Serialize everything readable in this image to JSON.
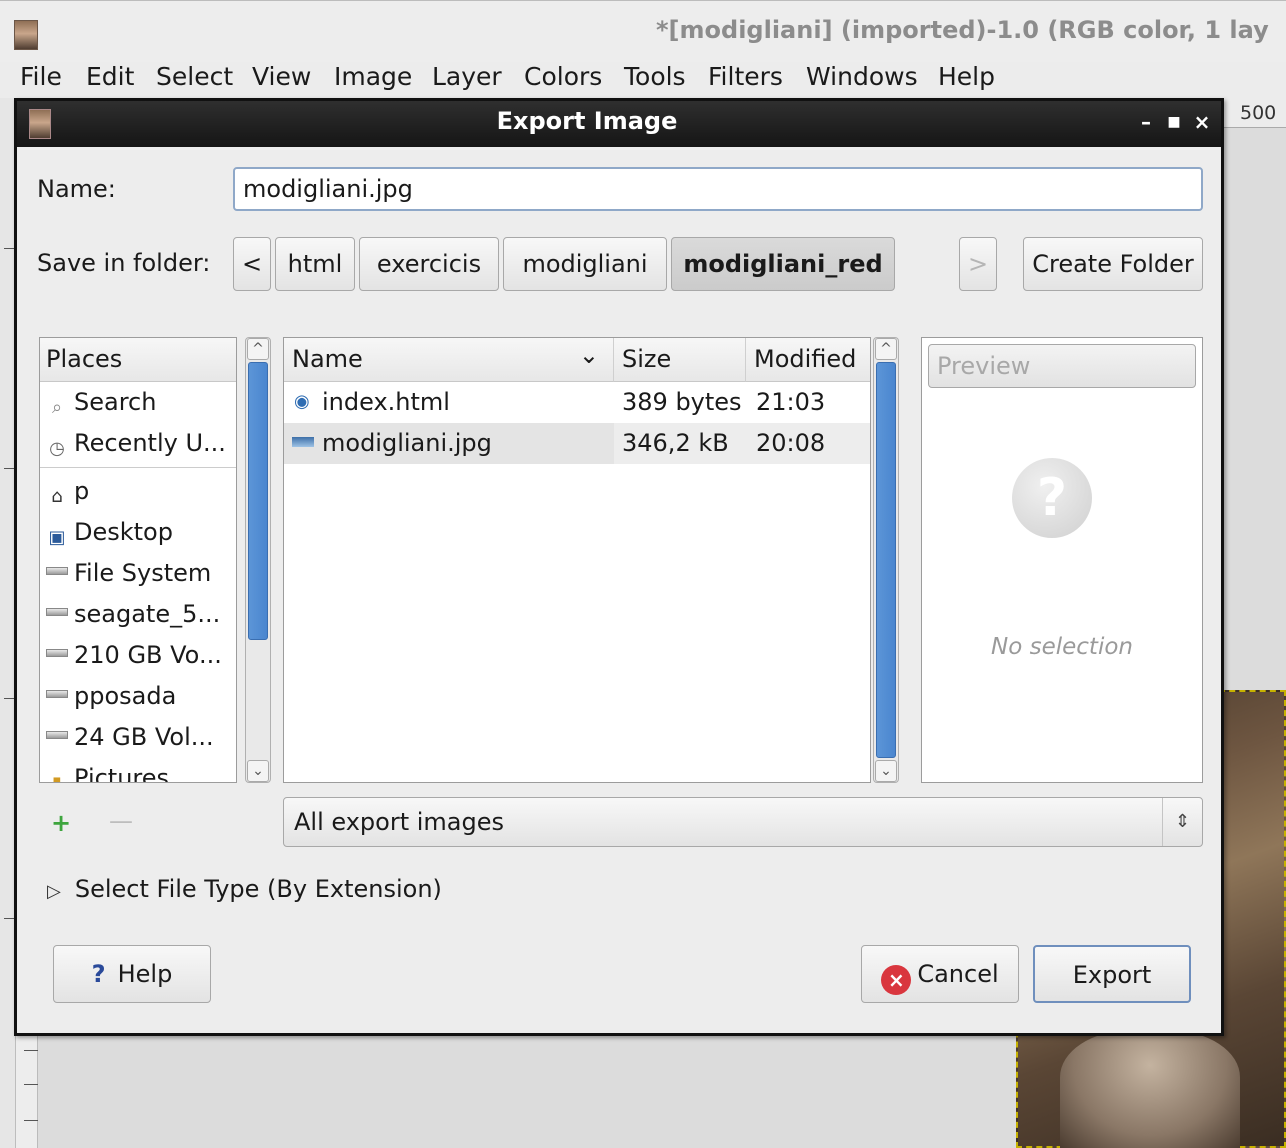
{
  "window": {
    "title": "*[modigliani] (imported)-1.0 (RGB color, 1 lay",
    "ruler_label": "500"
  },
  "menubar": [
    {
      "label": "File"
    },
    {
      "label": "Edit"
    },
    {
      "label": "Select"
    },
    {
      "label": "View"
    },
    {
      "label": "Image"
    },
    {
      "label": "Layer"
    },
    {
      "label": "Colors"
    },
    {
      "label": "Tools"
    },
    {
      "label": "Filters"
    },
    {
      "label": "Windows"
    },
    {
      "label": "Help"
    }
  ],
  "dialog": {
    "title": "Export Image",
    "name_label": "Name:",
    "name_value": "modigliani.jpg",
    "folder_label": "Save in folder:",
    "breadcrumb": {
      "back": "<",
      "items": [
        "html",
        "exercicis",
        "modigliani",
        "modigliani_red"
      ],
      "forward": ">"
    },
    "create_folder_label": "Create Folder",
    "places": {
      "header": "Places",
      "items": [
        {
          "label": "Search",
          "icon": "search-icon"
        },
        {
          "label": "Recently U...",
          "icon": "clock-icon"
        },
        {
          "label": "p",
          "icon": "home-icon"
        },
        {
          "label": "Desktop",
          "icon": "desktop-icon"
        },
        {
          "label": "File System",
          "icon": "drive-icon"
        },
        {
          "label": "seagate_5...",
          "icon": "drive-icon"
        },
        {
          "label": "210 GB Vo...",
          "icon": "drive-icon"
        },
        {
          "label": "pposada",
          "icon": "drive-icon"
        },
        {
          "label": "24 GB Vol...",
          "icon": "drive-icon"
        },
        {
          "label": "Pictures",
          "icon": "folder-icon"
        }
      ],
      "add_symbol": "+",
      "remove_symbol": "—"
    },
    "files": {
      "columns": [
        "Name",
        "Size",
        "Modified"
      ],
      "sort_indicator": "⌄",
      "rows": [
        {
          "name": "index.html",
          "size": "389 bytes",
          "modified": "21:03",
          "icon": "html-file-icon"
        },
        {
          "name": "modigliani.jpg",
          "size": "346,2 kB",
          "modified": "20:08",
          "icon": "image-file-icon"
        }
      ]
    },
    "preview": {
      "button_label": "Preview",
      "placeholder_text": "No selection"
    },
    "filter_value": "All export images",
    "file_type_expander": "Select File Type (By Extension)",
    "buttons": {
      "help": "Help",
      "help_glyph": "?",
      "cancel": "Cancel",
      "export": "Export"
    }
  },
  "colors": {
    "accent": "#4a86cf",
    "cancel_red": "#d9363e",
    "title_bar": "#1e1e1e"
  }
}
